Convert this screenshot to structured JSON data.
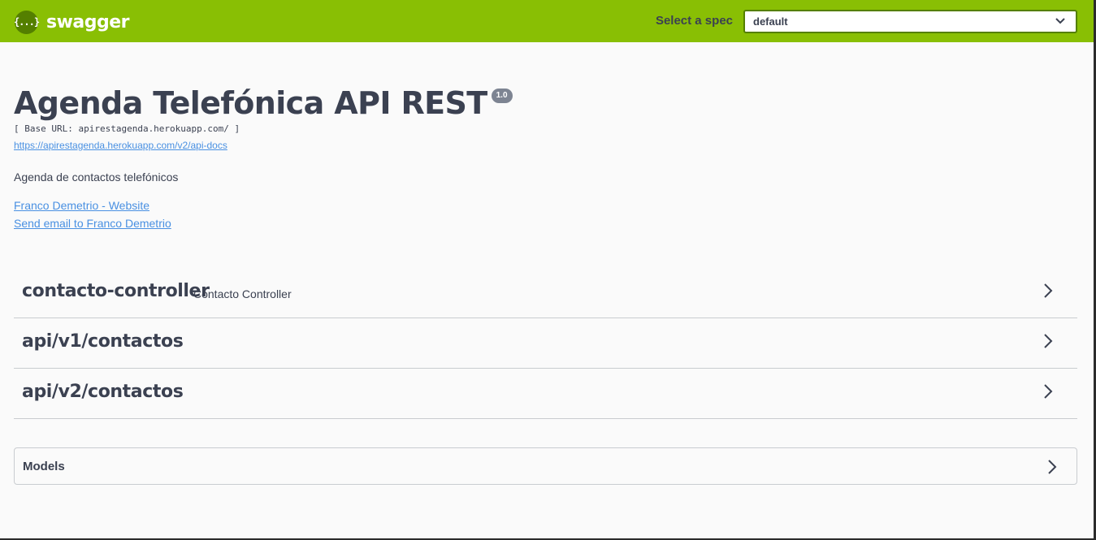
{
  "topbar": {
    "brand_icon_text": "{...}",
    "brand_name": "swagger",
    "brand_color": "#89bf04",
    "spec_label": "Select a spec",
    "spec_selected": "default"
  },
  "info": {
    "title": "Agenda Telefónica API REST",
    "version": "1.0",
    "base_url": "[ Base URL: apirestagenda.herokuapp.com/ ]",
    "api_docs_link": "https://apirestagenda.herokuapp.com/v2/api-docs",
    "description": "Agenda de contactos telefónicos",
    "contact_website": "Franco Demetrio - Website",
    "contact_email": "Send email to Franco Demetrio"
  },
  "tags": [
    {
      "name": "contacto-controller",
      "description": "Contacto Controller"
    },
    {
      "name": "api/v1/contactos",
      "description": ""
    },
    {
      "name": "api/v2/contactos",
      "description": ""
    }
  ],
  "models": {
    "title": "Models"
  },
  "icons": {
    "logo": "swagger-logo-icon",
    "select_chevron": "chevron-down-icon",
    "tag_chevron": "chevron-right-icon"
  }
}
